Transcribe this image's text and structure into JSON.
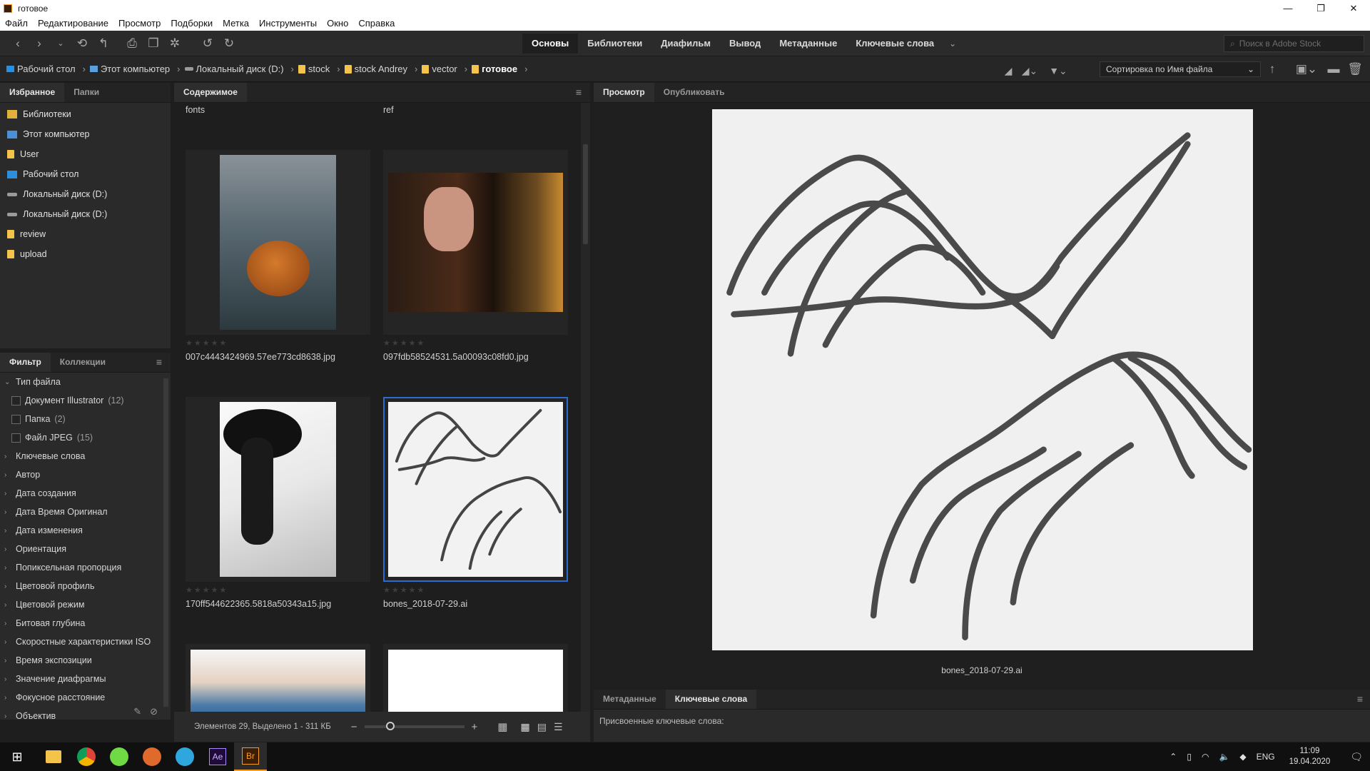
{
  "window": {
    "title": "готовое",
    "minimize": "—",
    "maximize": "❐",
    "close": "✕"
  },
  "menu": [
    "Файл",
    "Редактирование",
    "Просмотр",
    "Подборки",
    "Метка",
    "Инструменты",
    "Окно",
    "Справка"
  ],
  "workspaces": [
    "Основы",
    "Библиотеки",
    "Диафильм",
    "Вывод",
    "Метаданные",
    "Ключевые слова"
  ],
  "search": {
    "placeholder": "Поиск в Adobe Stock"
  },
  "breadcrumb": [
    {
      "label": "Рабочий стол",
      "icon": "desktop-icon"
    },
    {
      "label": "Этот компьютер",
      "icon": "computer-icon"
    },
    {
      "label": "Локальный диск (D:)",
      "icon": "disk-icon"
    },
    {
      "label": "stock",
      "icon": "folder-icon"
    },
    {
      "label": "stock Andrey",
      "icon": "folder-icon"
    },
    {
      "label": "vector",
      "icon": "folder-icon"
    },
    {
      "label": "готовое",
      "icon": "folder-icon"
    }
  ],
  "sort": {
    "label": "Сортировка по Имя файла"
  },
  "left_tabs": {
    "favorites": "Избранное",
    "folders": "Папки"
  },
  "favorites": [
    {
      "label": "Библиотеки",
      "icon": "libraries-icon"
    },
    {
      "label": "Этот компьютер",
      "icon": "computer-icon"
    },
    {
      "label": "User",
      "icon": "folder-icon"
    },
    {
      "label": "Рабочий стол",
      "icon": "desktop-icon"
    },
    {
      "label": "Локальный диск (D:)",
      "icon": "disk-icon"
    },
    {
      "label": "Локальный диск (D:)",
      "icon": "disk-icon"
    },
    {
      "label": "review",
      "icon": "folder-icon"
    },
    {
      "label": "upload",
      "icon": "folder-icon"
    }
  ],
  "filter_tabs": {
    "filter": "Фильтр",
    "collections": "Коллекции"
  },
  "filter": {
    "file_type": "Тип файла",
    "file_type_items": [
      {
        "label": "Документ Illustrator",
        "count": "(12)"
      },
      {
        "label": "Папка",
        "count": "(2)"
      },
      {
        "label": "Файл JPEG",
        "count": "(15)"
      }
    ],
    "groups": [
      "Ключевые слова",
      "Автор",
      "Дата создания",
      "Дата Время Оригинал",
      "Дата изменения",
      "Ориентация",
      "Попиксельная пропорция",
      "Цветовой профиль",
      "Цветовой режим",
      "Битовая глубина",
      "Скоростные характеристики ISO",
      "Время экспозиции",
      "Значение диафрагмы",
      "Фокусное расстояние",
      "Объектив"
    ]
  },
  "content": {
    "tab": "Содержимое",
    "folders": [
      "fonts",
      "ref"
    ],
    "items": [
      {
        "name": "007c4443424969.57ee773cd8638.jpg"
      },
      {
        "name": "097fdb58524531.5a00093c08fd0.jpg"
      },
      {
        "name": "170ff544622365.5818a50343a15.jpg"
      },
      {
        "name": "bones_2018-07-29.ai"
      }
    ],
    "rating_stars": "★★★★★",
    "status": "Элементов 29, Выделено 1 - 311 КБ"
  },
  "preview": {
    "tabs": [
      "Просмотр",
      "Опубликовать"
    ],
    "filename": "bones_2018-07-29.ai"
  },
  "meta": {
    "tabs": [
      "Метаданные",
      "Ключевые слова"
    ],
    "assigned": "Присвоенные ключевые слова:"
  },
  "taskbar": {
    "lang": "ENG",
    "time": "11:09",
    "date": "19.04.2020",
    "ae": "Ae",
    "br": "Br"
  },
  "colors": {
    "accent": "#2c6bd2",
    "folder": "#f3c34a",
    "bridge": "#f59a23"
  }
}
